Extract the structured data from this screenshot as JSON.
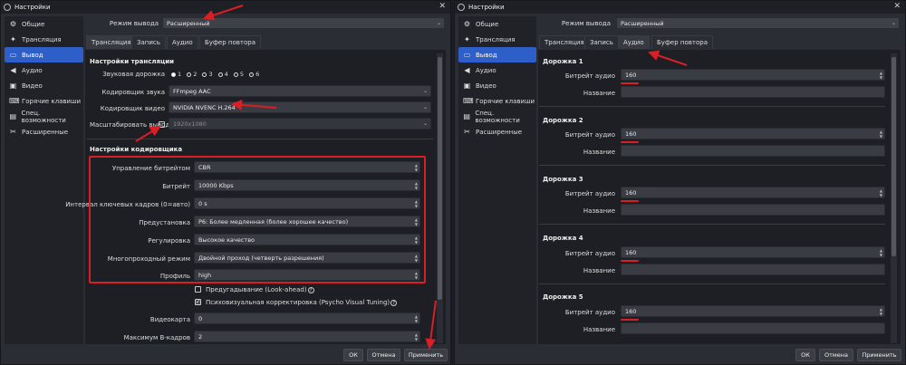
{
  "left": {
    "title": "Настройки",
    "close": "✕",
    "sidebar": [
      {
        "label": "Общие",
        "icon": "⚙"
      },
      {
        "label": "Трансляция",
        "icon": "✦"
      },
      {
        "label": "Вывод",
        "icon": "▭"
      },
      {
        "label": "Аудио",
        "icon": "◀"
      },
      {
        "label": "Видео",
        "icon": "▣"
      },
      {
        "label": "Горячие клавиши",
        "icon": "⌨"
      },
      {
        "label": "Спец. возможности",
        "icon": "▤"
      },
      {
        "label": "Расширенные",
        "icon": "✂"
      }
    ],
    "output_mode_label": "Режим вывода",
    "output_mode_value": "Расширенный",
    "tabs": [
      "Трансляция",
      "Запись",
      "Аудио",
      "Буфер повтора"
    ],
    "stream_section": "Настройки трансляции",
    "audio_track_label": "Звуковая дорожка",
    "audio_tracks": [
      "1",
      "2",
      "3",
      "4",
      "5",
      "6"
    ],
    "audio_encoder_label": "Кодировщик звука",
    "audio_encoder_value": "FFmpeg AAC",
    "video_encoder_label": "Кодировщик видео",
    "video_encoder_value": "NVIDIA NVENC H.264",
    "rescale_label": "Масштабировать вывод",
    "rescale_value": "1920x1080",
    "encoder_section": "Настройки кодировщика",
    "rate_control_label": "Управление битрейтом",
    "rate_control_value": "CBR",
    "bitrate_label": "Битрейт",
    "bitrate_value": "10000 Kbps",
    "keyframe_label": "Интервал ключевых кадров (0=авто)",
    "keyframe_value": "0 s",
    "preset_label": "Предустановка",
    "preset_value": "P6: Более медленная (более хорошее качество)",
    "tuning_label": "Регулировка",
    "tuning_value": "Высокое качество",
    "multipass_label": "Многопроходный режим",
    "multipass_value": "Двойной проход (четверть разрешения)",
    "profile_label": "Профиль",
    "profile_value": "high",
    "lookahead_label": "Предугадывание (Look-ahead)",
    "psycho_label": "Психовизуальная корректировка (Psycho Visual Tuning)",
    "help": "?",
    "gpu_label": "Видеокарта",
    "gpu_value": "0",
    "bframes_label": "Максимум B-кадров",
    "bframes_value": "2",
    "buttons": {
      "ok": "ОК",
      "cancel": "Отмена",
      "apply": "Применить"
    }
  },
  "right": {
    "title": "Настройки",
    "close": "✕",
    "sidebar": [
      {
        "label": "Общие",
        "icon": "⚙"
      },
      {
        "label": "Трансляция",
        "icon": "✦"
      },
      {
        "label": "Вывод",
        "icon": "▭"
      },
      {
        "label": "Аудио",
        "icon": "◀"
      },
      {
        "label": "Видео",
        "icon": "▣"
      },
      {
        "label": "Горячие клавиши",
        "icon": "⌨"
      },
      {
        "label": "Спец. возможности",
        "icon": "▤"
      },
      {
        "label": "Расширенные",
        "icon": "✂"
      }
    ],
    "output_mode_label": "Режим вывода",
    "output_mode_value": "Расширенный",
    "tabs": [
      "Трансляция",
      "Запись",
      "Аудио",
      "Буфер повтора"
    ],
    "tracks": [
      {
        "title": "Дорожка 1",
        "bitrate_label": "Битрейт аудио",
        "bitrate_value": "160",
        "name_label": "Название",
        "name_value": ""
      },
      {
        "title": "Дорожка 2",
        "bitrate_label": "Битрейт аудио",
        "bitrate_value": "160",
        "name_label": "Название",
        "name_value": ""
      },
      {
        "title": "Дорожка 3",
        "bitrate_label": "Битрейт аудио",
        "bitrate_value": "160",
        "name_label": "Название",
        "name_value": ""
      },
      {
        "title": "Дорожка 4",
        "bitrate_label": "Битрейт аудио",
        "bitrate_value": "160",
        "name_label": "Название",
        "name_value": ""
      },
      {
        "title": "Дорожка 5",
        "bitrate_label": "Битрейт аудио",
        "bitrate_value": "160",
        "name_label": "Название",
        "name_value": ""
      }
    ],
    "buttons": {
      "ok": "ОК",
      "cancel": "Отмена",
      "apply": "Применить"
    }
  },
  "colors": {
    "accent": "#2e5ec7",
    "annotation": "#d81f26",
    "background": "#2b2d34"
  }
}
